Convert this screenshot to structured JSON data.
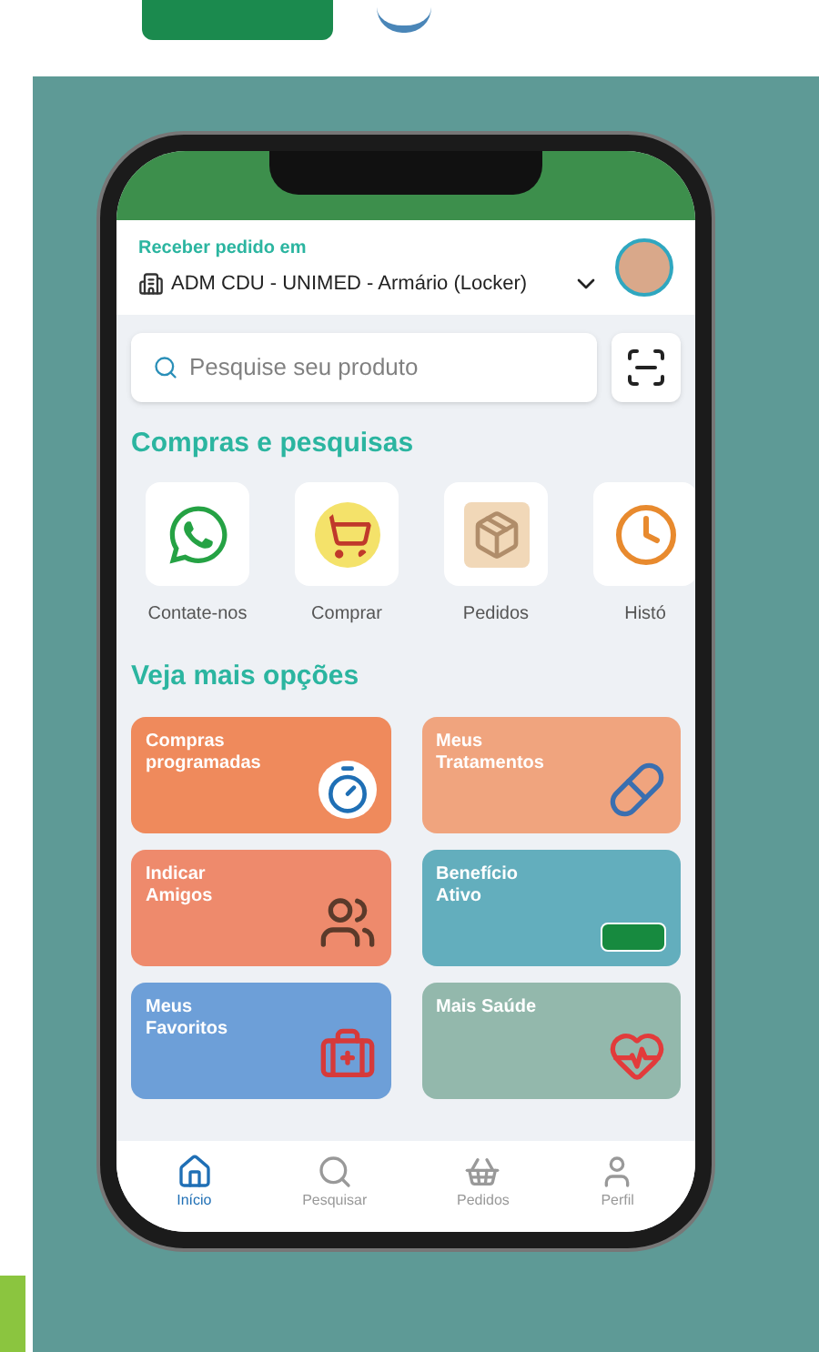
{
  "header": {
    "label": "Receber pedido em",
    "location": "ADM CDU - UNIMED - Armário (Locker)"
  },
  "search": {
    "placeholder": "Pesquise seu produto"
  },
  "shortcuts_title": "Compras e pesquisas",
  "shortcuts": [
    {
      "kind": "chat",
      "label": "Contate-nos"
    },
    {
      "kind": "cart",
      "label": "Comprar"
    },
    {
      "kind": "bag",
      "label": "Pedidos"
    },
    {
      "kind": "clock",
      "label": "Histó"
    }
  ],
  "options_title": "Veja mais opções",
  "cards": [
    {
      "kind": "timer",
      "title": "Compras programadas",
      "color": "#ef8a5c"
    },
    {
      "kind": "pills",
      "title": "Meus Tratamentos",
      "color": "#f0a47e"
    },
    {
      "kind": "friends",
      "title": "Indicar Amigos",
      "color": "#ee8a6c"
    },
    {
      "kind": "badge",
      "title": "Benefício Ativo",
      "color": "#63aebd"
    },
    {
      "kind": "kit",
      "title": "Meus Favoritos",
      "color": "#6d9fd8"
    },
    {
      "kind": "heart",
      "title": "Mais Saúde",
      "color": "#93b8ac"
    }
  ],
  "nav": [
    {
      "kind": "home",
      "label": "Início",
      "selected": true
    },
    {
      "kind": "search",
      "label": "Pesquisar",
      "selected": false
    },
    {
      "kind": "basket",
      "label": "Pedidos",
      "selected": false
    },
    {
      "kind": "user",
      "label": "Perfil",
      "selected": false
    }
  ]
}
